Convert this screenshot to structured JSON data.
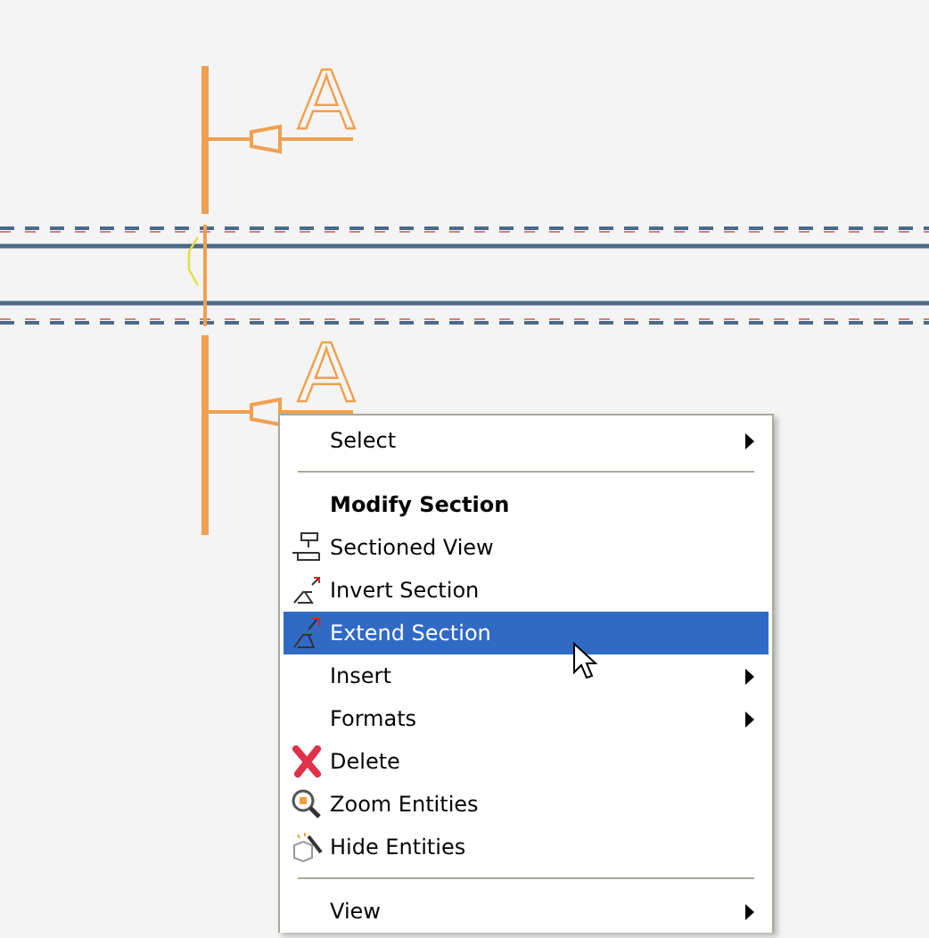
{
  "drawing": {
    "section_labels": [
      "A",
      "A"
    ]
  },
  "context_menu": {
    "items": [
      {
        "kind": "item",
        "label": "Select",
        "selected": false,
        "submenu": true
      },
      {
        "kind": "separator"
      },
      {
        "kind": "header",
        "label": "Modify Section"
      },
      {
        "kind": "item",
        "label": "Sectioned View",
        "selected": false,
        "submenu": false
      },
      {
        "kind": "item",
        "label": "Invert Section",
        "selected": false,
        "submenu": false
      },
      {
        "kind": "item",
        "label": "Extend Section",
        "selected": true,
        "submenu": false
      },
      {
        "kind": "item",
        "label": "Insert",
        "selected": false,
        "submenu": true
      },
      {
        "kind": "item",
        "label": "Formats",
        "selected": false,
        "submenu": true
      },
      {
        "kind": "item",
        "label": "Delete",
        "selected": false,
        "submenu": false
      },
      {
        "kind": "item",
        "label": "Zoom Entities",
        "selected": false,
        "submenu": false
      },
      {
        "kind": "item",
        "label": "Hide Entities",
        "selected": false,
        "submenu": false
      },
      {
        "kind": "separator"
      },
      {
        "kind": "item",
        "label": "View",
        "selected": false,
        "submenu": true
      }
    ]
  }
}
